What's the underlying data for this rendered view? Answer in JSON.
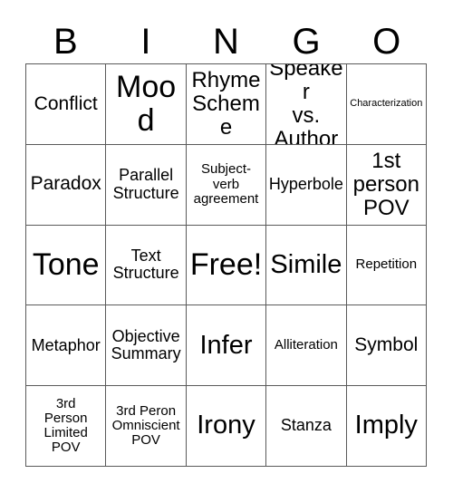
{
  "card": {
    "header": {
      "letters": [
        "B",
        "I",
        "N",
        "G",
        "O"
      ]
    },
    "rows": [
      [
        {
          "label": "Conflict",
          "size": "fs-md"
        },
        {
          "label": "Mood",
          "size": "fs-xxl"
        },
        {
          "label": "Rhyme\nScheme",
          "size": "fs-lg"
        },
        {
          "label": "Speaker\nvs.\nAuthor",
          "size": "fs-lg"
        },
        {
          "label": "Characterization",
          "size": "fs-xxs"
        }
      ],
      [
        {
          "label": "Paradox",
          "size": "fs-md"
        },
        {
          "label": "Parallel\nStructure",
          "size": "fs-sm"
        },
        {
          "label": "Subject-\nverb\nagreement",
          "size": "fs-xs"
        },
        {
          "label": "Hyperbole",
          "size": "fs-sm"
        },
        {
          "label": "1st\nperson\nPOV",
          "size": "fs-lg"
        }
      ],
      [
        {
          "label": "Tone",
          "size": "fs-xxl"
        },
        {
          "label": "Text\nStructure",
          "size": "fs-sm"
        },
        {
          "label": "Free!",
          "size": "fs-xxl"
        },
        {
          "label": "Simile",
          "size": "fs-xl"
        },
        {
          "label": "Repetition",
          "size": "fs-xs"
        }
      ],
      [
        {
          "label": "Metaphor",
          "size": "fs-sm"
        },
        {
          "label": "Objective\nSummary",
          "size": "fs-sm"
        },
        {
          "label": "Infer",
          "size": "fs-xl"
        },
        {
          "label": "Alliteration",
          "size": "fs-xs"
        },
        {
          "label": "Symbol",
          "size": "fs-md"
        }
      ],
      [
        {
          "label": "3rd\nPerson\nLimited\nPOV",
          "size": "fs-xs"
        },
        {
          "label": "3rd Peron\nOmniscient\nPOV",
          "size": "fs-xs"
        },
        {
          "label": "Irony",
          "size": "fs-xl"
        },
        {
          "label": "Stanza",
          "size": "fs-sm"
        },
        {
          "label": "Imply",
          "size": "fs-xl"
        }
      ]
    ]
  },
  "colors": {
    "grid_line": "#5a5a5a",
    "text": "#000000",
    "background": "#ffffff"
  }
}
